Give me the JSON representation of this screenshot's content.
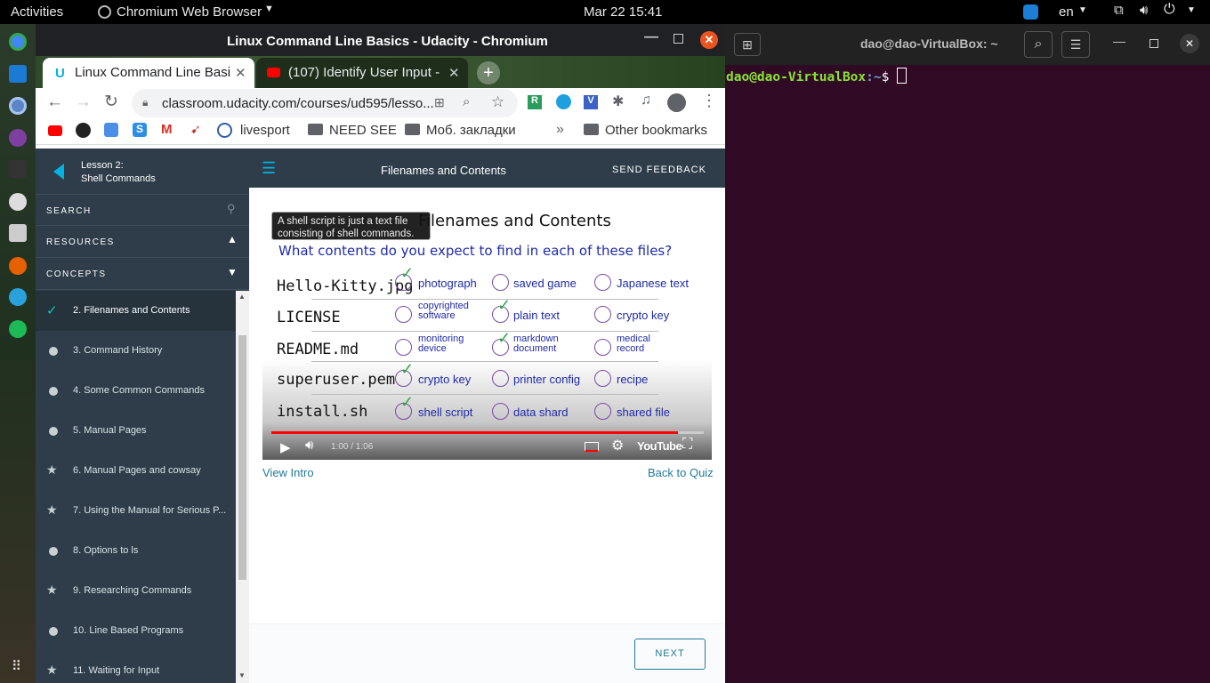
{
  "topbar": {
    "activities": "Activities",
    "app_name": "Chromium Web Browser",
    "datetime": "Mar 22  15:41",
    "lang": "en"
  },
  "browser": {
    "window_title": "Linux Command Line Basics - Udacity - Chromium",
    "tabs": [
      {
        "label": "Linux Command Line Basi"
      },
      {
        "label": "(107) Identify User Input -"
      }
    ],
    "url": "classroom.udacity.com/courses/ud595/lesso...",
    "bookmarks": [
      "livesport",
      "NEED SEE",
      "Моб. закладки",
      "Other bookmarks"
    ]
  },
  "sidebar": {
    "lesson_line1": "Lesson 2:",
    "lesson_line2": "Shell Commands",
    "search": "SEARCH",
    "resources": "RESOURCES",
    "concepts": "CONCEPTS",
    "items": [
      {
        "label": "2. Filenames and Contents"
      },
      {
        "label": "3. Command History"
      },
      {
        "label": "4. Some Common Commands"
      },
      {
        "label": "5. Manual Pages"
      },
      {
        "label": "6. Manual Pages and cowsay"
      },
      {
        "label": "7. Using the Manual for Serious P..."
      },
      {
        "label": "8. Options to ls"
      },
      {
        "label": "9. Researching Commands"
      },
      {
        "label": "10. Line Based Programs"
      },
      {
        "label": "11. Waiting for Input"
      }
    ]
  },
  "header": {
    "title": "Filenames and Contents",
    "feedback": "SEND FEEDBACK"
  },
  "video": {
    "caption_line1": "A shell script is just a text file",
    "caption_line2": "consisting of shell commands.",
    "board_title": "Filenames and Contents",
    "question": "What contents do you expect to find in each of these files?",
    "rows": [
      {
        "file": "Hello-Kitty.jpg",
        "opts": [
          "photograph",
          "saved game",
          "Japanese text"
        ]
      },
      {
        "file": "LICENSE",
        "opts": [
          "copyrighted software",
          "plain text",
          "crypto key"
        ]
      },
      {
        "file": "README.md",
        "opts": [
          "monitoring device",
          "markdown document",
          "medical record"
        ]
      },
      {
        "file": "superuser.pem",
        "opts": [
          "crypto key",
          "printer config",
          "recipe"
        ]
      },
      {
        "file": "install.sh",
        "opts": [
          "shell script",
          "data shard",
          "shared file"
        ]
      }
    ],
    "time": "1:00 / 1:06",
    "progress": 0.94,
    "youtube": "YouTube"
  },
  "links": {
    "view_intro": "View Intro",
    "back_to_quiz": "Back to Quiz",
    "next": "NEXT"
  },
  "terminal": {
    "title": "dao@dao-VirtualBox: ~",
    "prompt_user": "dao@dao-VirtualBox",
    "prompt_path": ":~",
    "prompt_sym": "$ "
  }
}
